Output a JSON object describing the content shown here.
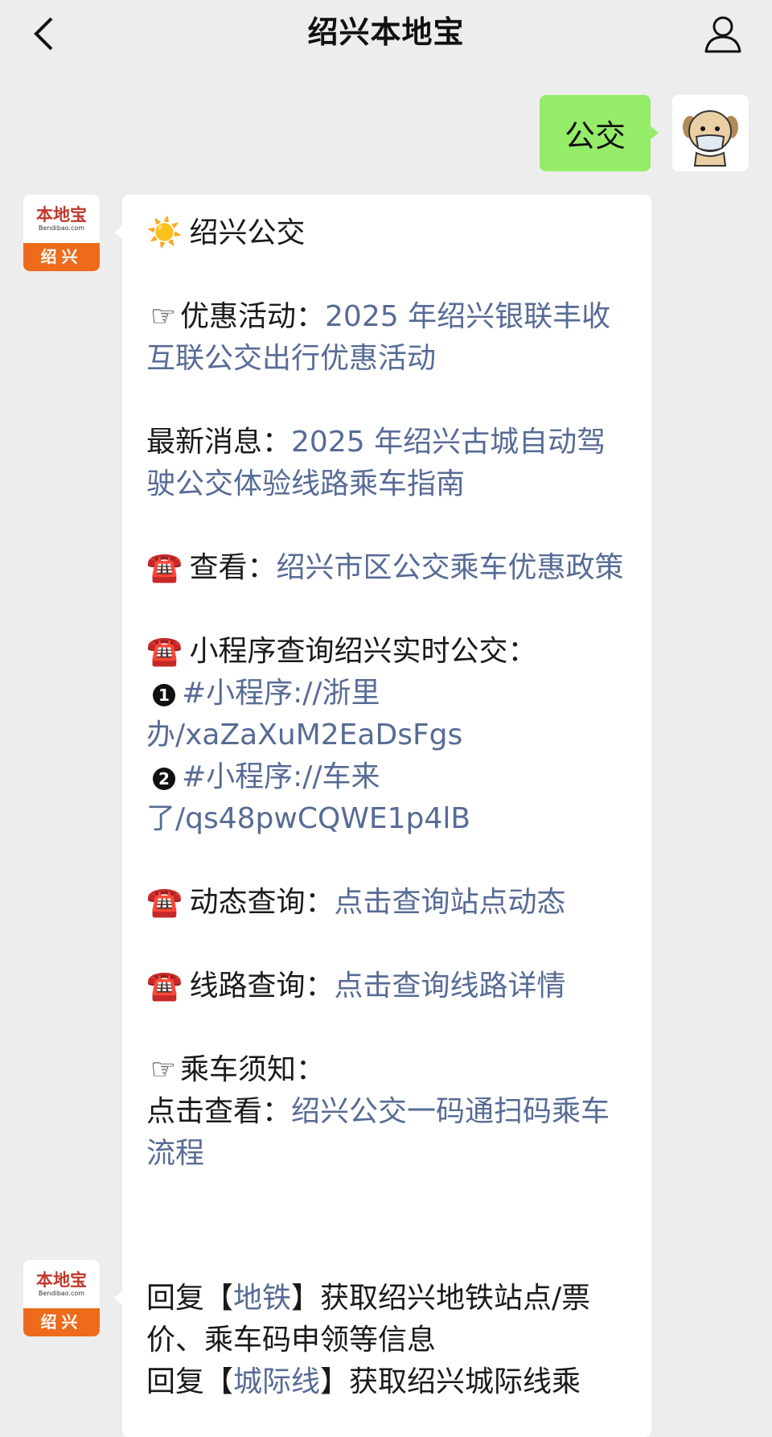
{
  "header": {
    "title": "绍兴本地宝"
  },
  "messages": {
    "user_msg": "公交",
    "bot_avatar": {
      "logo": "本地宝",
      "domain": "Bendibao.com",
      "city": "绍兴"
    },
    "bot1": {
      "heading_icon": "☀️",
      "heading": "绍兴公交",
      "promo_icon": "☞",
      "promo_label": "优惠活动：",
      "promo_link": "2025 年绍兴银联丰收互联公交出行优惠活动",
      "news_label": "最新消息：",
      "news_link": "2025 年绍兴古城自动驾驶公交体验线路乘车指南",
      "phone_icon": "☎️",
      "view_label": "查看：",
      "view_link": "绍兴市区公交乘车优惠政策",
      "mini_label": "小程序查询绍兴实时公交：",
      "mini1_num": "1",
      "mini1_link": "#小程序://浙里办/xaZaXuM2EaDsFgs",
      "mini2_num": "2",
      "mini2_link": "#小程序://车来了/qs48pwCQWE1p4lB",
      "dyn_label": "动态查询：",
      "dyn_link": "点击查询站点动态",
      "route_label": "线路查询：",
      "route_link": "点击查询线路详情",
      "notice_icon": "☞",
      "notice_label": "乘车须知：",
      "notice_prefix": "点击查看：",
      "notice_link": "绍兴公交一码通扫码乘车流程"
    },
    "bot2": {
      "line1_pre": "回复【",
      "line1_link": "地铁",
      "line1_post": "】获取绍兴地铁站点/票价、乘车码申领等信息",
      "line2_pre": "回复【",
      "line2_link": "城际线",
      "line2_post": "】获取绍兴城际线乘"
    }
  },
  "colors": {
    "link": "#576b95",
    "user_bubble": "#95ec69",
    "brand_orange": "#ee6b1c"
  },
  "icons": [
    "back-chevron-icon",
    "profile-icon",
    "sun-icon",
    "pointing-hand-icon",
    "telephone-icon"
  ]
}
